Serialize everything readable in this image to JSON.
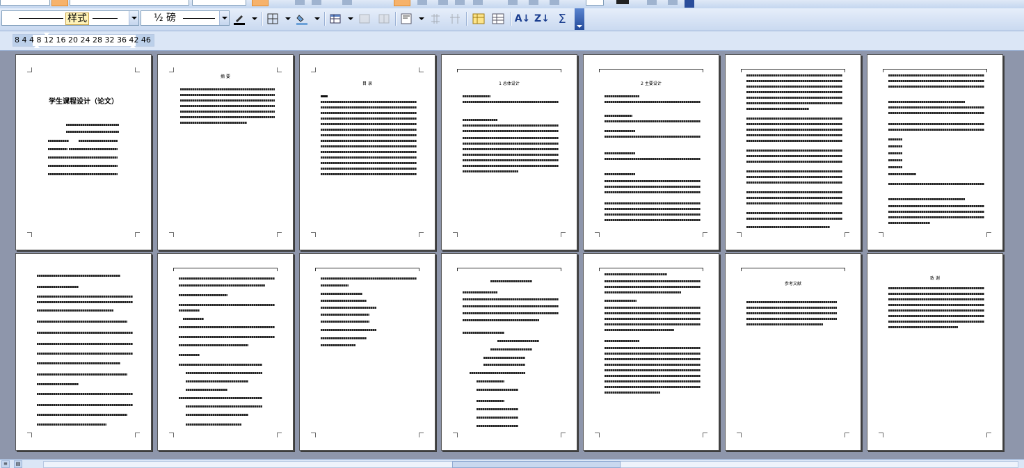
{
  "toolbar": {
    "style_label": "样式",
    "size_label": "½ 磅",
    "sort_az_label": "A↓",
    "sort_za_label": "Z↓",
    "sum_label": "Σ"
  },
  "ruler": {
    "numbers": "8  4     4  8  12 16 20 24 28 32 36   42 46"
  },
  "pages": {
    "p1": {
      "title": "学生课程设计（论文）"
    },
    "p2": {
      "title": "摘 要"
    },
    "p3": {
      "title": "目 录"
    },
    "p4": {
      "title": "1 总体设计"
    },
    "p5": {
      "title": "2 主要设计"
    },
    "p12": {
      "title": "参考文献"
    },
    "p13": {
      "title": "致 谢"
    }
  },
  "status": {
    "view_normal": "≡",
    "view_layout": "▤"
  }
}
